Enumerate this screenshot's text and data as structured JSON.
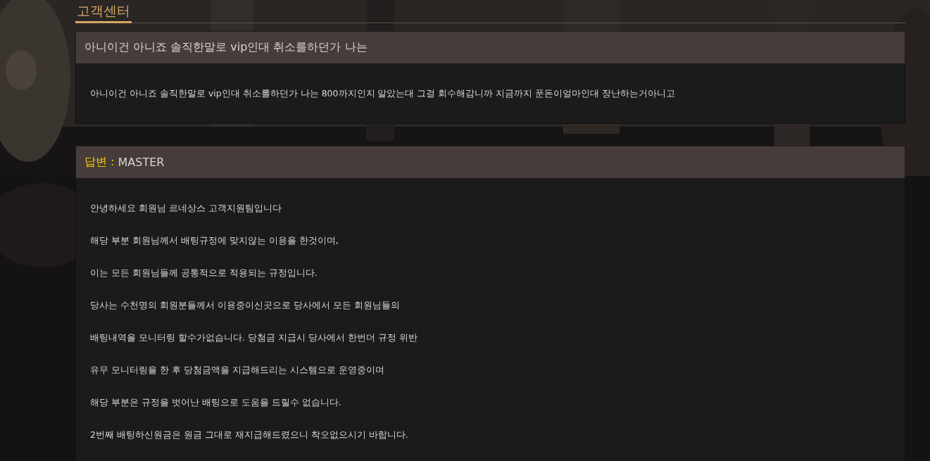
{
  "page_title": "고객센터",
  "question": {
    "title": "아니이건 아니죠 솔직한말로 vip인대 취소를하던가 나는",
    "body": "아니이건 아니죠 솔직한말로 vip인대 취소를하던가 나는 800까지인지 알았는대 그걸 회수해감니까 지금까지 푼돈이얼마인대 장난하는거아니고"
  },
  "answer": {
    "label": "답변 :",
    "author": "MASTER",
    "lines": [
      "안녕하세요 회원님 르네상스 고객지원팀입니다",
      "해당 부분 회원님께서 배팅규정에 맞지않는 이용을 한것이며,",
      "이는 모든 회원님들께 공통적으로 적용되는 규정입니다.",
      "당사는 수천명의 회원분들께서 이용중이신곳으로 당사에서 모든 회원님들의",
      "배팅내역을 모니터링 할수가없습니다. 당첨금 지급시 당사에서 한번더 규정 위반",
      "유무 모니터링을 한 후 당첨금액을 지급해드리는 시스템으로 운영중이며",
      "해당 부분은 규정을 벗어난 배팅으로 도움을 드릴수 없습니다.",
      "2번째 배팅하신원금은 원금 그대로 재지급해드렸으니 착오없으시기 바랍니다."
    ]
  }
}
